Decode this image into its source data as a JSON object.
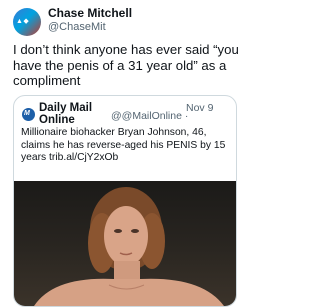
{
  "tweet": {
    "author_name": "Chase Mitchell",
    "author_handle": "@ChaseMit",
    "text": "I don’t think anyone has ever said “you have the penis of a 31 year old” as a compliment"
  },
  "quote": {
    "source_name": "Daily Mail Online",
    "source_handle": "@@MailOnline",
    "separator": "·",
    "date": "Nov 9",
    "text": "Millionaire biohacker Bryan Johnson, 46, claims he has reverse-aged his PENIS by 15 years trib.al/CjY2xOb",
    "logo_letter": "M"
  },
  "colors": {
    "handle_gray": "#536471",
    "border": "#cfd9de",
    "logo_blue": "#1d5fa8"
  }
}
